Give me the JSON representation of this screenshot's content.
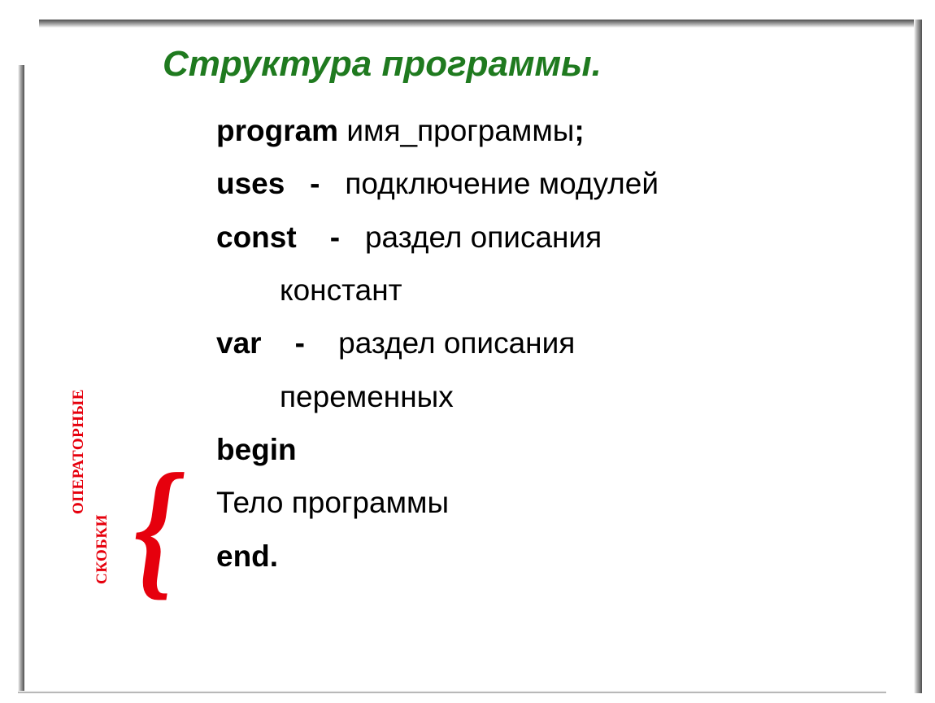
{
  "title": "Структура программы.",
  "lines": {
    "l1_bold": "program ",
    "l1_rest": "имя_программы",
    "l1_end": ";",
    "l2_bold": "uses",
    "l2_dash": "   -   ",
    "l2_rest": "подключение модулей",
    "l3_bold": "const",
    "l3_dash": "    -   ",
    "l3_rest": "раздел описания",
    "l3_cont": "констант",
    "l4_bold": "var",
    "l4_dash": "    -    ",
    "l4_rest": "раздел описания",
    "l4_cont": "переменных",
    "l5_bold": "begin",
    "l6": "Тело программы",
    "l7_bold": "end."
  },
  "brace": "{",
  "sidelabel1": "ОПЕРАТОРНЫЕ",
  "sidelabel2": "СКОБКИ"
}
